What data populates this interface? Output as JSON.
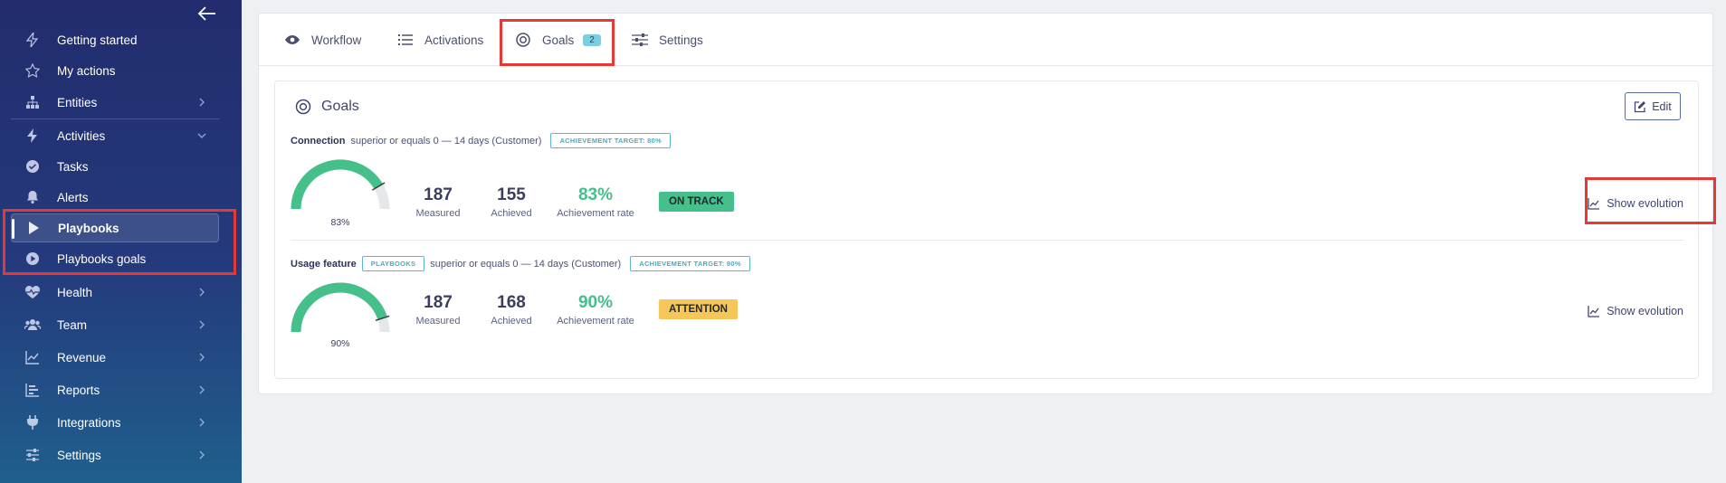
{
  "sidebar": {
    "items": [
      {
        "label": "Getting started",
        "icon": "bolt-icon"
      },
      {
        "label": "My actions",
        "icon": "star-icon"
      },
      {
        "label": "Entities",
        "icon": "hierarchy-icon"
      },
      {
        "label": "Activities",
        "icon": "bolt-icon"
      },
      {
        "label": "Tasks",
        "icon": "check-circle-icon"
      },
      {
        "label": "Alerts",
        "icon": "bell-icon"
      },
      {
        "label": "Playbooks",
        "icon": "play-icon"
      },
      {
        "label": "Playbooks goals",
        "icon": "play-circle-icon"
      },
      {
        "label": "Health",
        "icon": "heart-pulse-icon"
      },
      {
        "label": "Team",
        "icon": "users-icon"
      },
      {
        "label": "Revenue",
        "icon": "chart-line-icon"
      },
      {
        "label": "Reports",
        "icon": "bar-list-icon"
      },
      {
        "label": "Integrations",
        "icon": "plug-icon"
      },
      {
        "label": "Settings",
        "icon": "sliders-icon"
      }
    ]
  },
  "tabs": [
    {
      "label": "Workflow",
      "icon": "eye-icon"
    },
    {
      "label": "Activations",
      "icon": "list-icon"
    },
    {
      "label": "Goals",
      "icon": "target-icon",
      "count": "2"
    },
    {
      "label": "Settings",
      "icon": "sliders-icon"
    }
  ],
  "goals_panel": {
    "title": "Goals",
    "edit_label": "Edit",
    "goals": [
      {
        "name": "Connection",
        "condition": "superior or equals  0  — 14 days (Customer)",
        "tag": "",
        "target": "ACHIEVEMENT TARGET: 80%",
        "gauge_value": 0.83,
        "gauge_label": "83%",
        "measured": "187",
        "measured_label": "Measured",
        "achieved": "155",
        "achieved_label": "Achieved",
        "rate": "83%",
        "rate_label": "Achievement rate",
        "status": "ON TRACK",
        "evolution_label": "Show evolution"
      },
      {
        "name": "Usage feature",
        "condition": "superior or equals  0  — 14 days (Customer)",
        "tag": "PLAYBOOKS",
        "target": "ACHIEVEMENT TARGET: 90%",
        "gauge_value": 0.9,
        "gauge_label": "90%",
        "measured": "187",
        "measured_label": "Measured",
        "achieved": "168",
        "achieved_label": "Achieved",
        "rate": "90%",
        "rate_label": "Achievement rate",
        "status": "ATTENTION",
        "evolution_label": "Show evolution"
      }
    ]
  },
  "colors": {
    "accent_green": "#45c08a",
    "attention_yellow": "#f6c65a",
    "highlight_red": "#e53935",
    "sidebar_top": "#222c6e",
    "sidebar_bottom": "#1f5f8d"
  }
}
